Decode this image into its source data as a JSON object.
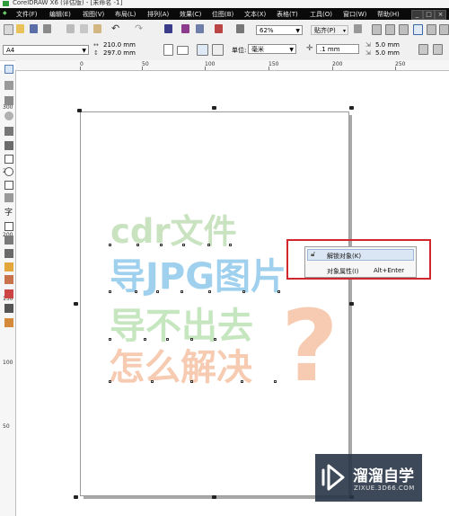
{
  "window": {
    "title": "CorelDRAW X6 (评估版) - [未命名 -1]"
  },
  "menu": {
    "items": [
      "文件(F)",
      "编辑(E)",
      "视图(V)",
      "布局(L)",
      "排列(A)",
      "效果(C)",
      "位图(B)",
      "文本(X)",
      "表格(T)",
      "工具(O)",
      "窗口(W)",
      "帮助(H)"
    ],
    "window_buttons": [
      "_",
      "□",
      "×"
    ]
  },
  "toolbar": {
    "zoom": "62%",
    "snap": "贴齐(P)"
  },
  "propbar": {
    "page_size": "A4",
    "width": "210.0 mm",
    "height": "297.0 mm",
    "unit_label": "单位:",
    "unit_value": "毫米",
    "nudge": ".1 mm",
    "dup_x": "5.0 mm",
    "dup_y": "5.0 mm"
  },
  "rulers": {
    "top": [
      "0",
      "50",
      "100",
      "150",
      "200",
      "250"
    ],
    "left": [
      "300",
      "250",
      "200",
      "150",
      "100",
      "50"
    ]
  },
  "artwork": {
    "line1": "cdr文件",
    "line2": "导JPG图片",
    "line3": "导不出去",
    "line4": "怎么解决",
    "mark": "?",
    "colors": {
      "line1": "#c9e3c1",
      "line2": "#9fd0ee",
      "line3": "#c6e6c0",
      "line4": "#f6cbb2",
      "mark": "#f6cbb2"
    }
  },
  "context_menu": {
    "items": [
      {
        "label": "解锁对象(K)",
        "shortcut": ""
      },
      {
        "label": "对象属性(I)",
        "shortcut": "Alt+Enter"
      }
    ],
    "highlight_color": "#d1262c"
  },
  "watermark": {
    "title": "溜溜自学",
    "subtitle": "ZIXUE.3D66.COM"
  }
}
